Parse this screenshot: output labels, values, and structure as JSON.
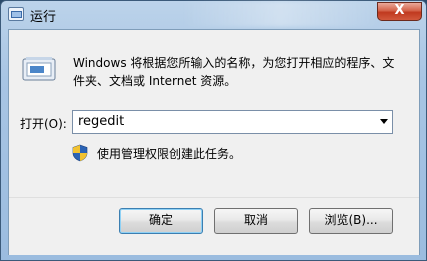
{
  "window": {
    "title": "运行",
    "close_symbol": "X"
  },
  "dialog": {
    "description": "Windows 将根据您所输入的名称，为您打开相应的程序、文件夹、文档或 Internet 资源。",
    "open_label": "打开(O):",
    "open_value": "regedit",
    "admin_notice": "使用管理权限创建此任务。"
  },
  "buttons": {
    "ok": "确定",
    "cancel": "取消",
    "browse": "浏览(B)..."
  },
  "icons": {
    "title": "run-icon",
    "dialog": "run-program-icon",
    "shield": "uac-shield-icon",
    "dropdown": "chevron-down-icon"
  }
}
